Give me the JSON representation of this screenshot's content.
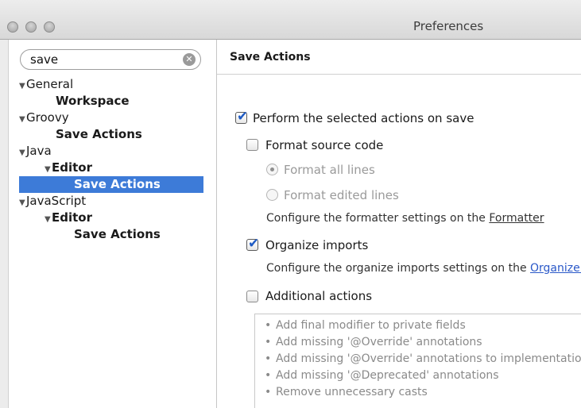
{
  "window": {
    "title": "Preferences"
  },
  "search": {
    "value": "save",
    "clear_icon": "clear-icon"
  },
  "tree": [
    {
      "label": "General",
      "arrow": "▼",
      "indent": 0,
      "bold": false,
      "selected": false
    },
    {
      "label": "Workspace",
      "arrow": "",
      "indent": 1,
      "bold": true,
      "selected": false
    },
    {
      "label": "Groovy",
      "arrow": "▼",
      "indent": 0,
      "bold": false,
      "selected": false
    },
    {
      "label": "Save Actions",
      "arrow": "",
      "indent": 1,
      "bold": true,
      "selected": false
    },
    {
      "label": "Java",
      "arrow": "▼",
      "indent": 0,
      "bold": false,
      "selected": false
    },
    {
      "label": "Editor",
      "arrow": "▼",
      "indent": 1,
      "bold": true,
      "selected": false
    },
    {
      "label": "Save Actions",
      "arrow": "",
      "indent": 2,
      "bold": true,
      "selected": true
    },
    {
      "label": "JavaScript",
      "arrow": "▼",
      "indent": 0,
      "bold": false,
      "selected": false
    },
    {
      "label": "Editor",
      "arrow": "▼",
      "indent": 1,
      "bold": true,
      "selected": false
    },
    {
      "label": "Save Actions",
      "arrow": "",
      "indent": 2,
      "bold": true,
      "selected": false
    }
  ],
  "page": {
    "title": "Save Actions",
    "perform": {
      "label": "Perform the selected actions on save",
      "checked": true
    },
    "format_source": {
      "label": "Format source code",
      "checked": false
    },
    "format_all": {
      "label": "Format all lines",
      "selected": true
    },
    "format_edited": {
      "label": "Format edited lines",
      "selected": false
    },
    "formatter_note": {
      "prefix": "Configure the formatter settings on the ",
      "link": "Formatter"
    },
    "organize": {
      "label": "Organize imports",
      "checked": true
    },
    "organize_note": {
      "prefix": "Configure the organize imports settings on the ",
      "link": "Organize Imports"
    },
    "additional": {
      "label": "Additional actions",
      "checked": false
    },
    "additional_items": [
      "Add final modifier to private fields",
      "Add missing '@Override' annotations",
      "Add missing '@Override' annotations to implementations of interface methods",
      "Add missing '@Deprecated' annotations",
      "Remove unnecessary casts"
    ]
  },
  "colors": {
    "selection": "#3d7bd8",
    "link": "#2a58c8",
    "check": "#1f5bc4"
  }
}
